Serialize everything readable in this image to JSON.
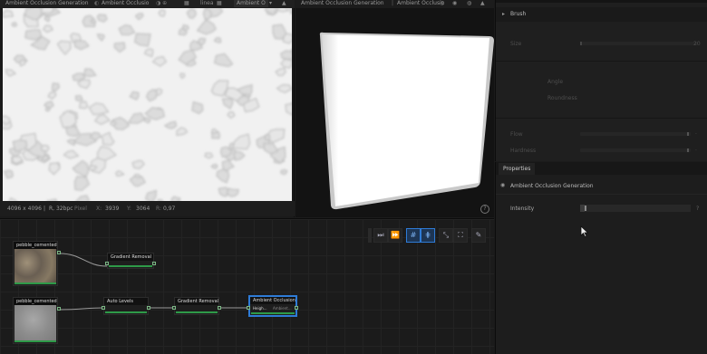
{
  "view2d": {
    "title": "Ambient Occlusion Generation",
    "output": "Ambient Occlusio",
    "channel_select": "Ambient O",
    "mode": "linea",
    "status": {
      "size": "4096 x 4096",
      "format": "R, 32bpc",
      "mode_label": "Pixel",
      "x_label": "X:",
      "x_value": "3939",
      "y_label": "Y:",
      "y_value": "3064",
      "r_label": "R:",
      "r_value": "0,97"
    }
  },
  "view3d": {
    "title": "Ambient Occlusion Generation",
    "output": "Ambient Occlusio",
    "help_glyph": "?"
  },
  "brush_panel": {
    "title": "Brush",
    "size_label": "Size",
    "size_value": "20",
    "angle_label": "Angle",
    "roundness_label": "Roundness",
    "flow_label": "Flow",
    "hardness_label": "Hardness"
  },
  "properties": {
    "tab": "Properties",
    "node_title": "Ambient Occlusion Generation",
    "intensity_label": "Intensity",
    "intensity_help": "?",
    "intensity_fraction": 0.04
  },
  "graph": {
    "nodes": [
      {
        "id": "n1",
        "title": "pebble_cemented_flo"
      },
      {
        "id": "n2",
        "title": "Gradient Removal"
      },
      {
        "id": "n3",
        "title": "pebble_cemented_flo"
      },
      {
        "id": "n4",
        "title": "Auto Levels"
      },
      {
        "id": "n5",
        "title": "Gradient Removal"
      },
      {
        "id": "n6",
        "title": "Ambient Occlusion...",
        "in_label": "Heigh...",
        "out_label": "Ambient..."
      }
    ],
    "toolbar": [
      "play-once-icon",
      "play-all-icon",
      "grid-snap-icon",
      "align-icon",
      "fit-in-icon",
      "fit-out-icon",
      "frame-icon",
      "comment-icon"
    ]
  },
  "colors": {
    "accent_blue": "#2e7bd6",
    "node_ok_green": "#2e9a48",
    "bg": "#1b1b1b"
  }
}
